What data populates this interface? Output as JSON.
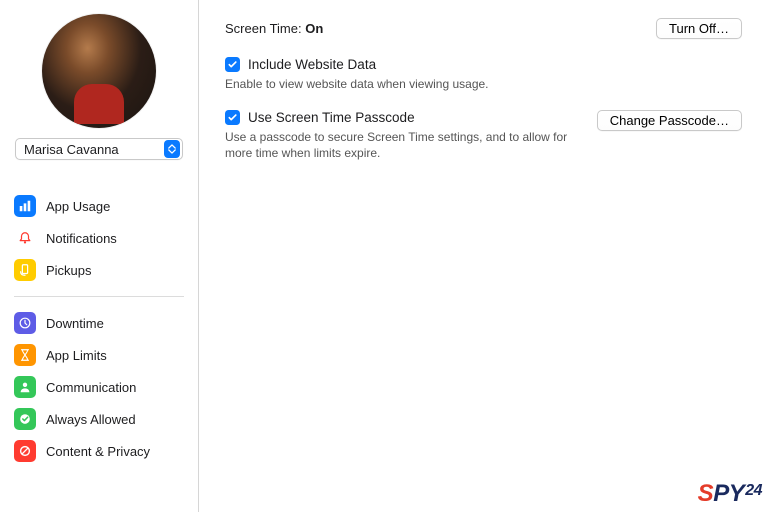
{
  "user": {
    "selected_name": "Marisa Cavanna"
  },
  "nav": {
    "group1": [
      {
        "label": "App Usage",
        "icon": "bar-chart-icon",
        "color": "#0a7aff"
      },
      {
        "label": "Notifications",
        "icon": "bell-icon",
        "color": "#ff3b30",
        "icon_only_bg": true
      },
      {
        "label": "Pickups",
        "icon": "hand-phone-icon",
        "color": "#ffcc00"
      }
    ],
    "group2": [
      {
        "label": "Downtime",
        "icon": "clock-icon",
        "color": "#5e5ce6"
      },
      {
        "label": "App Limits",
        "icon": "hourglass-icon",
        "color": "#ff9500"
      },
      {
        "label": "Communication",
        "icon": "person-icon",
        "color": "#34c759"
      },
      {
        "label": "Always Allowed",
        "icon": "check-seal-icon",
        "color": "#34c759"
      },
      {
        "label": "Content & Privacy",
        "icon": "nosign-icon",
        "color": "#ff3b30"
      }
    ]
  },
  "main": {
    "screentime_label": "Screen Time: ",
    "screentime_status": "On",
    "turn_off_label": "Turn Off…",
    "include_website_data": {
      "label": "Include Website Data",
      "desc": "Enable to view website data when viewing usage.",
      "checked": true
    },
    "use_passcode": {
      "label": "Use Screen Time Passcode",
      "desc": "Use a passcode to secure Screen Time settings, and to allow for more time when limits expire.",
      "checked": true,
      "button_label": "Change Passcode…"
    }
  },
  "watermark": {
    "s": "S",
    "py": "PY",
    "n24": "24"
  }
}
